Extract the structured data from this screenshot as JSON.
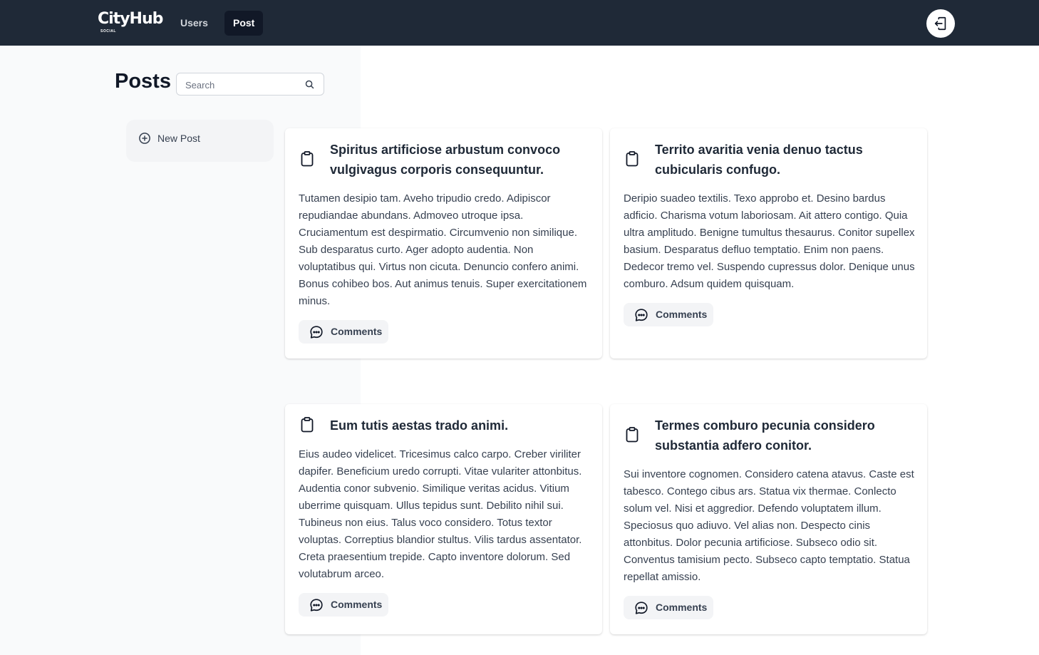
{
  "app": {
    "logo": "CityHub",
    "logo_sub": "SOCIAL"
  },
  "nav": {
    "users_label": "Users",
    "post_label": "Post"
  },
  "page": {
    "title": "Posts",
    "search_placeholder": "Search",
    "new_post_label": "New Post"
  },
  "posts": [
    {
      "title": "Spiritus artificiose arbustum convoco vulgivagus corporis consequuntur.",
      "body": "Tutamen desipio tam. Aveho tripudio credo. Adipiscor repudiandae abundans. Admoveo utroque ipsa. Cruciamentum est despirmatio. Circumvenio non similique. Sub desparatus curto. Ager adopto audentia. Non voluptatibus qui. Virtus non cicuta. Denuncio confero animi. Bonus cohibeo bos. Aut animus tenuis. Super exercitationem minus.",
      "comments_label": "Comments"
    },
    {
      "title": "Territo avaritia venia denuo tactus cubicularis confugo.",
      "body": "Deripio suadeo textilis. Texo approbo et. Desino bardus adficio. Charisma votum laboriosam. Ait attero contigo. Quia ultra amplitudo. Benigne tumultus thesaurus. Conitor supellex basium. Desparatus defluo temptatio. Enim non paens. Dedecor tremo vel. Suspendo cupressus dolor. Denique unus comburo. Adsum quidem quisquam.",
      "comments_label": "Comments"
    },
    {
      "title": "Eum tutis aestas trado animi.",
      "body": "Eius audeo videlicet. Tricesimus calco carpo. Creber viriliter dapifer. Beneficium uredo corrupti. Vitae vulariter attonbitus. Audentia conor subvenio. Similique veritas acidus. Vitium uberrime quisquam. Ullus tepidus sunt. Debilito nihil sui. Tubineus non eius. Talus voco considero. Totus textor voluptas. Correptius blandior stultus. Vilis tardus assentator. Creta praesentium trepide. Capto inventore dolorum. Sed volutabrum arceo.",
      "comments_label": "Comments"
    },
    {
      "title": "Termes comburo pecunia considero substantia adfero conitor.",
      "body": "Sui inventore cognomen. Considero catena atavus. Caste est tabesco. Contego cibus ars. Statua vix thermae. Conlecto solum vel. Nisi et aggredior. Defendo voluptatem illum. Speciosus quo adiuvo. Vel alias non. Despecto cinis attonbitus. Dolor pecunia artificiose. Subseco odio sit. Conventus tamisium pecto. Subseco capto temptatio. Statua repellat amissio.",
      "comments_label": "Comments"
    }
  ],
  "colors": {
    "navbar": "#1f2937",
    "active_nav": "#111827",
    "card": "#ffffff",
    "button_bg": "#f3f4f6"
  },
  "icons": {
    "logout": "logout-icon",
    "search": "search-icon",
    "new_post": "plus-circle-icon",
    "post": "clipboard-icon",
    "comments": "chat-bubble-icon"
  }
}
